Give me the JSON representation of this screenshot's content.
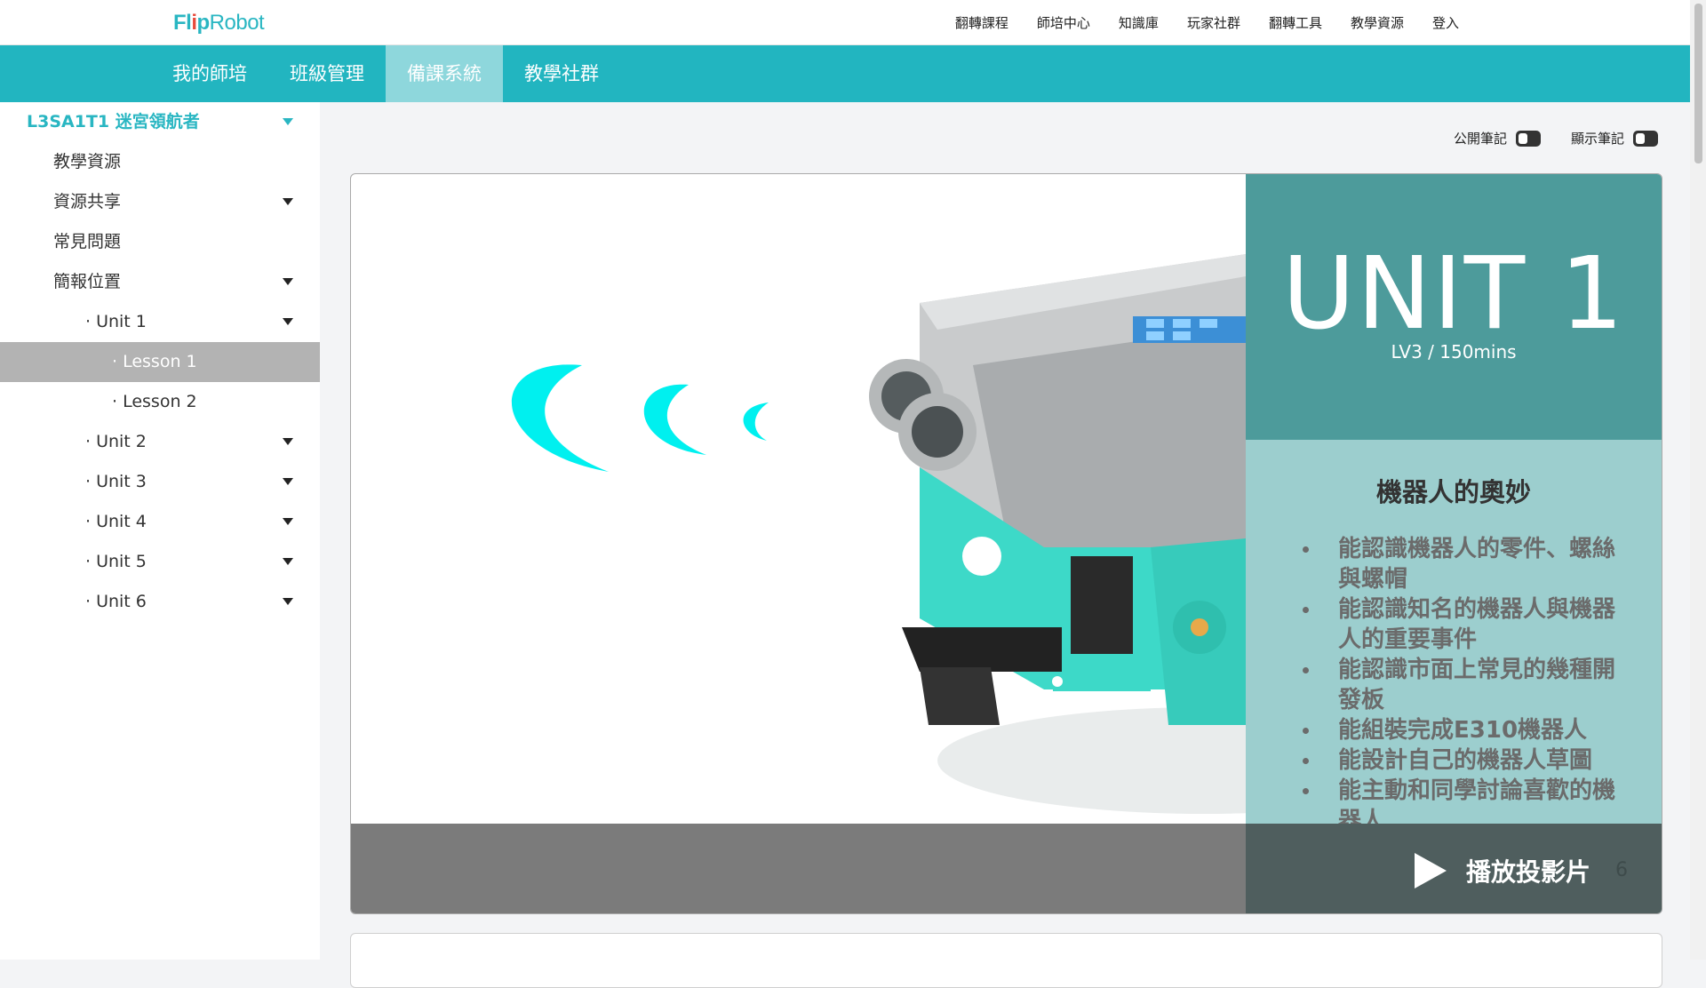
{
  "header": {
    "logo_prefix": "Fl",
    "logo_dot": "i",
    "logo_mid": "p",
    "logo_suffix": "Robot",
    "nav": [
      "翻轉課程",
      "師培中心",
      "知識庫",
      "玩家社群",
      "翻轉工具",
      "教學資源",
      "登入"
    ]
  },
  "mainnav": {
    "tabs": [
      {
        "label": "我的師培",
        "active": false
      },
      {
        "label": "班級管理",
        "active": false
      },
      {
        "label": "備課系統",
        "active": true
      },
      {
        "label": "教學社群",
        "active": false
      }
    ]
  },
  "sidebar": {
    "course": "L3SA1T1 迷宮領航者",
    "items": [
      {
        "label": "教學資源"
      },
      {
        "label": "資源共享"
      },
      {
        "label": "常見問題"
      },
      {
        "label": "簡報位置"
      },
      {
        "label": "· Unit 1"
      },
      {
        "label": "· Lesson 1"
      },
      {
        "label": "· Lesson 2"
      },
      {
        "label": "· Unit 2"
      },
      {
        "label": "· Unit 3"
      },
      {
        "label": "· Unit 4"
      },
      {
        "label": "· Unit 5"
      },
      {
        "label": "· Unit 6"
      }
    ]
  },
  "toggles": {
    "public_notes": "公開筆記",
    "show_notes": "顯示筆記"
  },
  "slide": {
    "unit_title": "UNIT 1",
    "unit_sub": "LV3 / 150mins",
    "heading": "機器人的奧妙",
    "goals": [
      "能認識機器人的零件、螺絲與螺帽",
      "能認識知名的機器人與機器人的重要事件",
      "能認識市面上常見的幾種開發板",
      "能組裝完成E310機器人",
      "能設計自己的機器人草圖",
      "能主動和同學討論喜歡的機器人"
    ],
    "play_label": "播放投影片",
    "page_number": "6"
  },
  "colors": {
    "brand_teal": "#22b5c0",
    "active_tab": "#8ed7dc",
    "slide_dark_teal": "#4d9b9b",
    "slide_light_teal": "#9ccece",
    "wave_cyan": "#00f0ef",
    "robot_teal": "#3dd9c8"
  }
}
